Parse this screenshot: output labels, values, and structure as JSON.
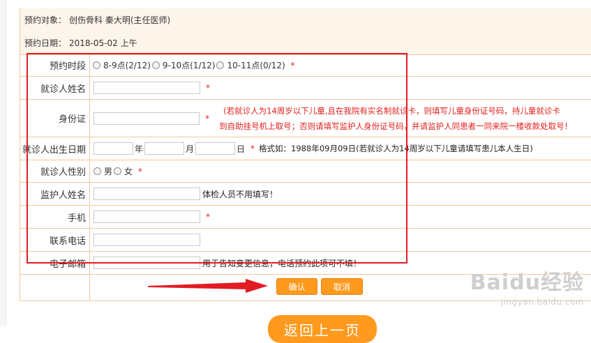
{
  "info": {
    "target_label": "预约对象：",
    "target_value": "创伤骨科 秦大明(主任医师)",
    "date_label": "预约日期：",
    "date_value": "2018-05-02 上午"
  },
  "form": {
    "slot": {
      "label": "预约时段",
      "options": [
        "8-9点(2/12)",
        "9-10点(1/12)",
        "10-11点(0/12)"
      ],
      "required": "*"
    },
    "name": {
      "label": "就诊人姓名",
      "required": "*"
    },
    "id_card": {
      "label": "身份证",
      "required": "*",
      "note_line1": "(若就诊人为14周岁以下儿童,且在我院有实名制就诊卡，则填写儿童身份证号码，持儿童就诊卡",
      "note_line2": "到自助挂号机上取号；否则请填写监护人身份证号码，并请监护人同患者一同来院一楼收款处取号！"
    },
    "birth": {
      "label": "就诊人出生日期",
      "year": "年",
      "month": "月",
      "day": "日",
      "required": "*",
      "format_hint": "格式如：1988年09月09日(若就诊人为14周岁以下儿童请填写患儿本人生日)"
    },
    "gender": {
      "label": "就诊人性别",
      "male": "男",
      "female": "女",
      "required": "*"
    },
    "guardian": {
      "label": "监护人姓名",
      "hint": "体检人员不用填写！"
    },
    "mobile": {
      "label": "手机",
      "required": "*"
    },
    "phone": {
      "label": "联系电话"
    },
    "email": {
      "label": "电子邮箱",
      "hint": "用于告知变更信息，电话预约此项可不填！"
    }
  },
  "buttons": {
    "confirm": "确认",
    "cancel": "取消",
    "back": "返回上一页"
  },
  "watermark": {
    "main": "Baidu经验",
    "sub": "jingyan.baidu.com"
  },
  "colors": {
    "border": "#f1c79e",
    "button": "#ff9a1f",
    "required": "#e0201e",
    "annotation": "#e31b23"
  }
}
